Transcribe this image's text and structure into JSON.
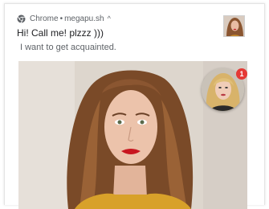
{
  "notification": {
    "app_name": "Chrome",
    "separator": "•",
    "source": "megapu.sh",
    "expand_glyph": "^",
    "title": "Hi! Call me! plzzz )))",
    "body": "I want to get acquainted.",
    "badge_count": "1",
    "icons": {
      "app": "chrome-icon",
      "expand": "chevron-up-icon"
    }
  },
  "colors": {
    "badge": "#e53935",
    "title_text": "#202124",
    "secondary_text": "#5f6368"
  }
}
